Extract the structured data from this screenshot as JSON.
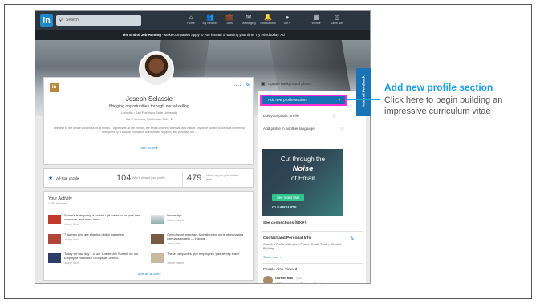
{
  "nav": {
    "logo": "in",
    "search_placeholder": "Search",
    "items": [
      {
        "label": "Home",
        "icon": "home-icon",
        "glyph": "⌂"
      },
      {
        "label": "My Network",
        "icon": "network-icon",
        "glyph": "👥"
      },
      {
        "label": "Jobs",
        "icon": "jobs-icon",
        "glyph": "💼"
      },
      {
        "label": "Messaging",
        "icon": "messaging-icon",
        "glyph": "✉"
      },
      {
        "label": "Notifications",
        "icon": "bell-icon",
        "glyph": "🔔"
      },
      {
        "label": "Me ▾",
        "icon": "me-icon",
        "glyph": "●"
      },
      {
        "label": "Work ▾",
        "icon": "grid-icon",
        "glyph": "▦"
      },
      {
        "label": "Sales Nav",
        "icon": "compass-icon",
        "glyph": "◎"
      }
    ]
  },
  "banner": {
    "bold": "The End of Job Hunting",
    "rest": " - Make companies apply to you instead of wasting your time! Try Hired today.",
    "ad": "Ad"
  },
  "profile": {
    "company_badge": "in",
    "more": "···",
    "name": "Joseph Selassie",
    "headline": "Bridging opportunities through social selling",
    "sub": "LinkedIn • San Francisco State University",
    "location": "San Francisco, California • 500+ ✚",
    "summary": "I believe in the innate goodness of all things. I appreciate all the friends, the small children, animals, and nature. My drive toward success is inherently energized by a natural inclination to empower, support, and positivity in t...",
    "see_more": "See more ▾"
  },
  "stats": {
    "allstar": "All-Star profile",
    "views_num": "104",
    "views_label": "Who's viewed your profile",
    "post_num": "479",
    "post_label": "Views of your post in the feed"
  },
  "activity": {
    "title": "Your Activity",
    "followers": "1,450 followers",
    "items": [
      {
        "text": "SpaceX is recycling a rocket, Lyft wants to be your new commute, and more news.",
        "by": "Joseph liked"
      },
      {
        "text": "Insider tips",
        "by": "Joseph shared"
      },
      {
        "text": "7 women who are shaping digital marketing",
        "by": "Joseph liked"
      },
      {
        "text": "One of most important & challenging parts of managing compassionately — Having...",
        "by": "Joseph liked"
      },
      {
        "text": "Today we had day 1 of our Leadership Summit for our Employee Resource Groups at LinkedI...",
        "by": "Joseph liked"
      },
      {
        "text": "These companies give employees 'paw-ternity leave'",
        "by": "Joseph shared"
      }
    ],
    "see_all": "See all activity"
  },
  "side": {
    "update_bg": "Update background photo",
    "add_section": "Add new profile section",
    "edit_public": "Edit your public profile",
    "add_language": "Add profile in another language",
    "ad": {
      "line1": "Cut through the",
      "line2": "Noise",
      "line3": "of Email",
      "button": "See Video Mail",
      "brand": "CLEARSLIDE"
    },
    "see_connections": "See connections (500+)",
    "contact_title": "Contact and Personal Info",
    "contact_text": "Joseph's Profile, Websites, Phone, Email, Twitter, IM, and Birthday",
    "show_more": "Show more ▾",
    "people_also_viewed": "People Also Viewed",
    "pav": {
      "name": "Gordon Mak",
      "degree": "• 1st",
      "role": "LMS Administrator | Customer Education"
    }
  },
  "feedback_tab": "Internal Feedback",
  "callout": {
    "title": "Add new profile section",
    "text": "Click here to begin building an impressive curriculum vitae"
  },
  "colors": {
    "accent": "#1ba1e2",
    "highlight": "#ff2fd6",
    "linkedin_blue": "#1a6fb5"
  }
}
